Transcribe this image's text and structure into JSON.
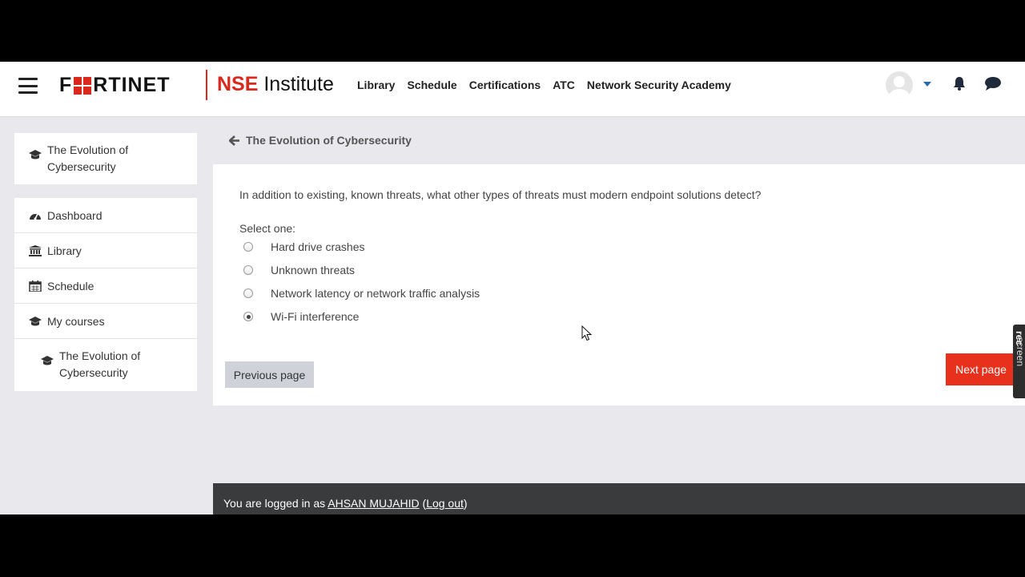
{
  "navbar": {
    "brand": "F RTINET",
    "brand_prefix": "F",
    "brand_suffix": "RTINET",
    "product_bold": "NSE",
    "product_rest": " Institute",
    "links": [
      "Library",
      "Schedule",
      "Certifications",
      "ATC",
      "Network Security Academy"
    ]
  },
  "sidebar": {
    "course_card": {
      "label": "The Evolution of Cybersecurity",
      "icon": "graduation-cap-icon"
    },
    "items": [
      {
        "label": "Dashboard",
        "icon": "dashboard-icon"
      },
      {
        "label": "Library",
        "icon": "library-icon"
      },
      {
        "label": "Schedule",
        "icon": "calendar-icon"
      },
      {
        "label": "My courses",
        "icon": "graduation-cap-icon"
      },
      {
        "label": "The Evolution of Cybersecurity",
        "icon": "graduation-cap-icon"
      }
    ]
  },
  "page": {
    "title": "The Evolution of Cybersecurity"
  },
  "quiz": {
    "question": "In addition to existing, known threats, what other types of threats must modern endpoint solutions detect?",
    "select_label": "Select one:",
    "options": [
      {
        "label": "Hard drive crashes",
        "checked": false
      },
      {
        "label": "Unknown threats",
        "checked": false
      },
      {
        "label": "Network latency or network traffic analysis",
        "checked": false
      },
      {
        "label": "Wi-Fi interference",
        "checked": true
      }
    ],
    "prev_label": "Previous page",
    "next_label": "Next page"
  },
  "footer": {
    "prefix": "You are logged in as ",
    "user": "AHSAN MUJAHID",
    "open_paren": " (",
    "logout": "Log out",
    "close_paren": ")"
  },
  "overlay": {
    "badge_a": "screen",
    "badge_b": "rec"
  },
  "colors": {
    "accent_red": "#e8311d",
    "brand_red": "#da291c",
    "footer_bg": "#3a3b3d"
  }
}
